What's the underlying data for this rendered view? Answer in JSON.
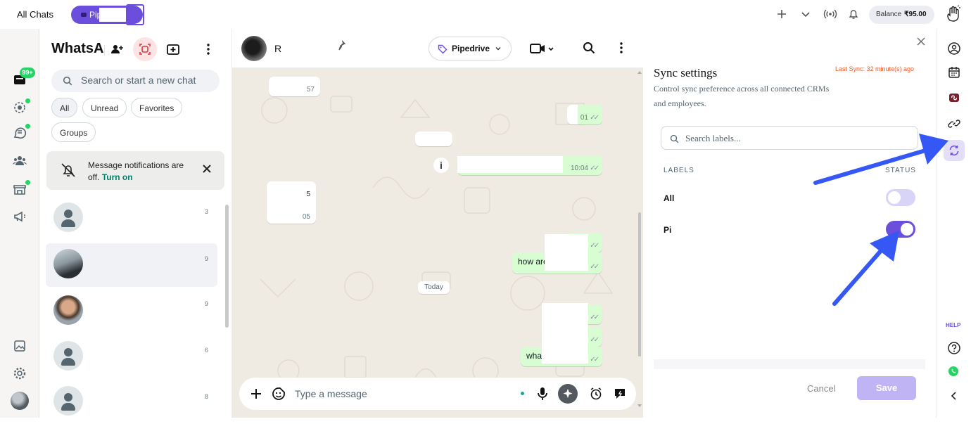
{
  "topbar": {
    "tab_all": "All Chats",
    "tab_active": "Pip",
    "balance_label": "Balance",
    "balance_value": "₹95.00"
  },
  "rail": {
    "badge": "99+"
  },
  "chatlist": {
    "title": "WhatsApp",
    "search_placeholder": "Search or start a new chat",
    "filters": [
      "All",
      "Unread",
      "Favorites",
      "Groups"
    ],
    "notification": {
      "text": "Message notifications are off.",
      "action": "Turn on"
    },
    "rows": [
      {
        "time": "3"
      },
      {
        "time": "9"
      },
      {
        "time": "9"
      },
      {
        "time": "6"
      },
      {
        "time": "8"
      }
    ]
  },
  "conversation": {
    "contact_name": "R",
    "crm_button": "Pipedrive",
    "messages": {
      "m1_time": "57",
      "m2_time": "01",
      "m3_time": "10:04",
      "m4_text": "5",
      "m4_time": "05",
      "m5_text": "how are",
      "m6_text": "wha"
    },
    "date_divider": "Today",
    "input_placeholder": "Type a message"
  },
  "sync": {
    "title": "Sync settings",
    "last_sync": "Last Sync: 32 minute(s) ago",
    "description": "Control sync preference across all connected CRMs and employees.",
    "search_placeholder": "Search labels...",
    "col_labels": "LABELS",
    "col_status": "STATUS",
    "labels": [
      {
        "name": "All",
        "enabled": false
      },
      {
        "name": "Pi",
        "enabled": true
      }
    ],
    "cancel": "Cancel",
    "save": "Save"
  },
  "right_rail": {
    "help": "HELP"
  },
  "colors": {
    "accent": "#6b4fdc",
    "whatsapp_green": "#25d366",
    "outgoing_bubble": "#d9fdd3",
    "chat_bg": "#efeae2",
    "arrow": "#3457f5",
    "last_sync": "#f05a28"
  }
}
